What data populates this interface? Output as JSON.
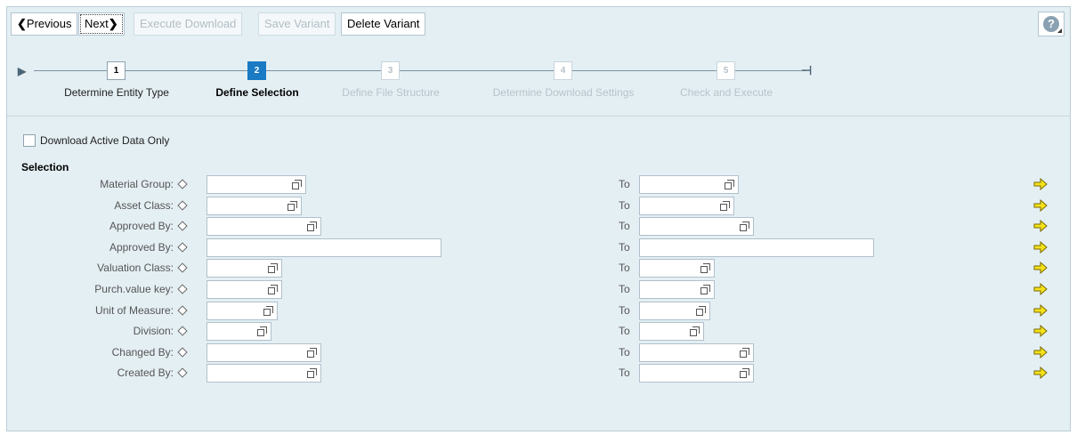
{
  "toolbar": {
    "previous_label": "Previous",
    "next_label": "Next",
    "execute_download_label": "Execute Download",
    "save_variant_label": "Save Variant",
    "delete_variant_label": "Delete Variant",
    "help_icon": "help-icon",
    "help_glyph": "?"
  },
  "roadmap": {
    "steps": [
      {
        "number": "1",
        "label": "Determine Entity Type",
        "state": "done"
      },
      {
        "number": "2",
        "label": "Define Selection",
        "state": "active"
      },
      {
        "number": "3",
        "label": "Define File Structure",
        "state": "inactive"
      },
      {
        "number": "4",
        "label": "Determine Download Settings",
        "state": "inactive"
      },
      {
        "number": "5",
        "label": "Check and Execute",
        "state": "inactive"
      }
    ]
  },
  "options": {
    "download_active_label": "Download Active Data Only",
    "download_active_checked": false
  },
  "selection": {
    "title": "Selection",
    "to_label": "To",
    "rows": [
      {
        "label": "Material Group:",
        "from_value": "",
        "to_value": ""
      },
      {
        "label": "Asset Class:",
        "from_value": "",
        "to_value": ""
      },
      {
        "label": "Approved By:",
        "from_value": "",
        "to_value": ""
      },
      {
        "label": "Approved By:",
        "from_value": "",
        "to_value": ""
      },
      {
        "label": "Valuation Class:",
        "from_value": "",
        "to_value": ""
      },
      {
        "label": "Purch.value key:",
        "from_value": "",
        "to_value": ""
      },
      {
        "label": "Unit of Measure:",
        "from_value": "",
        "to_value": ""
      },
      {
        "label": "Division:",
        "from_value": "",
        "to_value": ""
      },
      {
        "label": "Changed By:",
        "from_value": "",
        "to_value": ""
      },
      {
        "label": "Created By:",
        "from_value": "",
        "to_value": ""
      }
    ]
  },
  "colors": {
    "background": "#e4eff4",
    "active_step": "#1b7ac4",
    "arrow_fill": "#f5e21a"
  }
}
